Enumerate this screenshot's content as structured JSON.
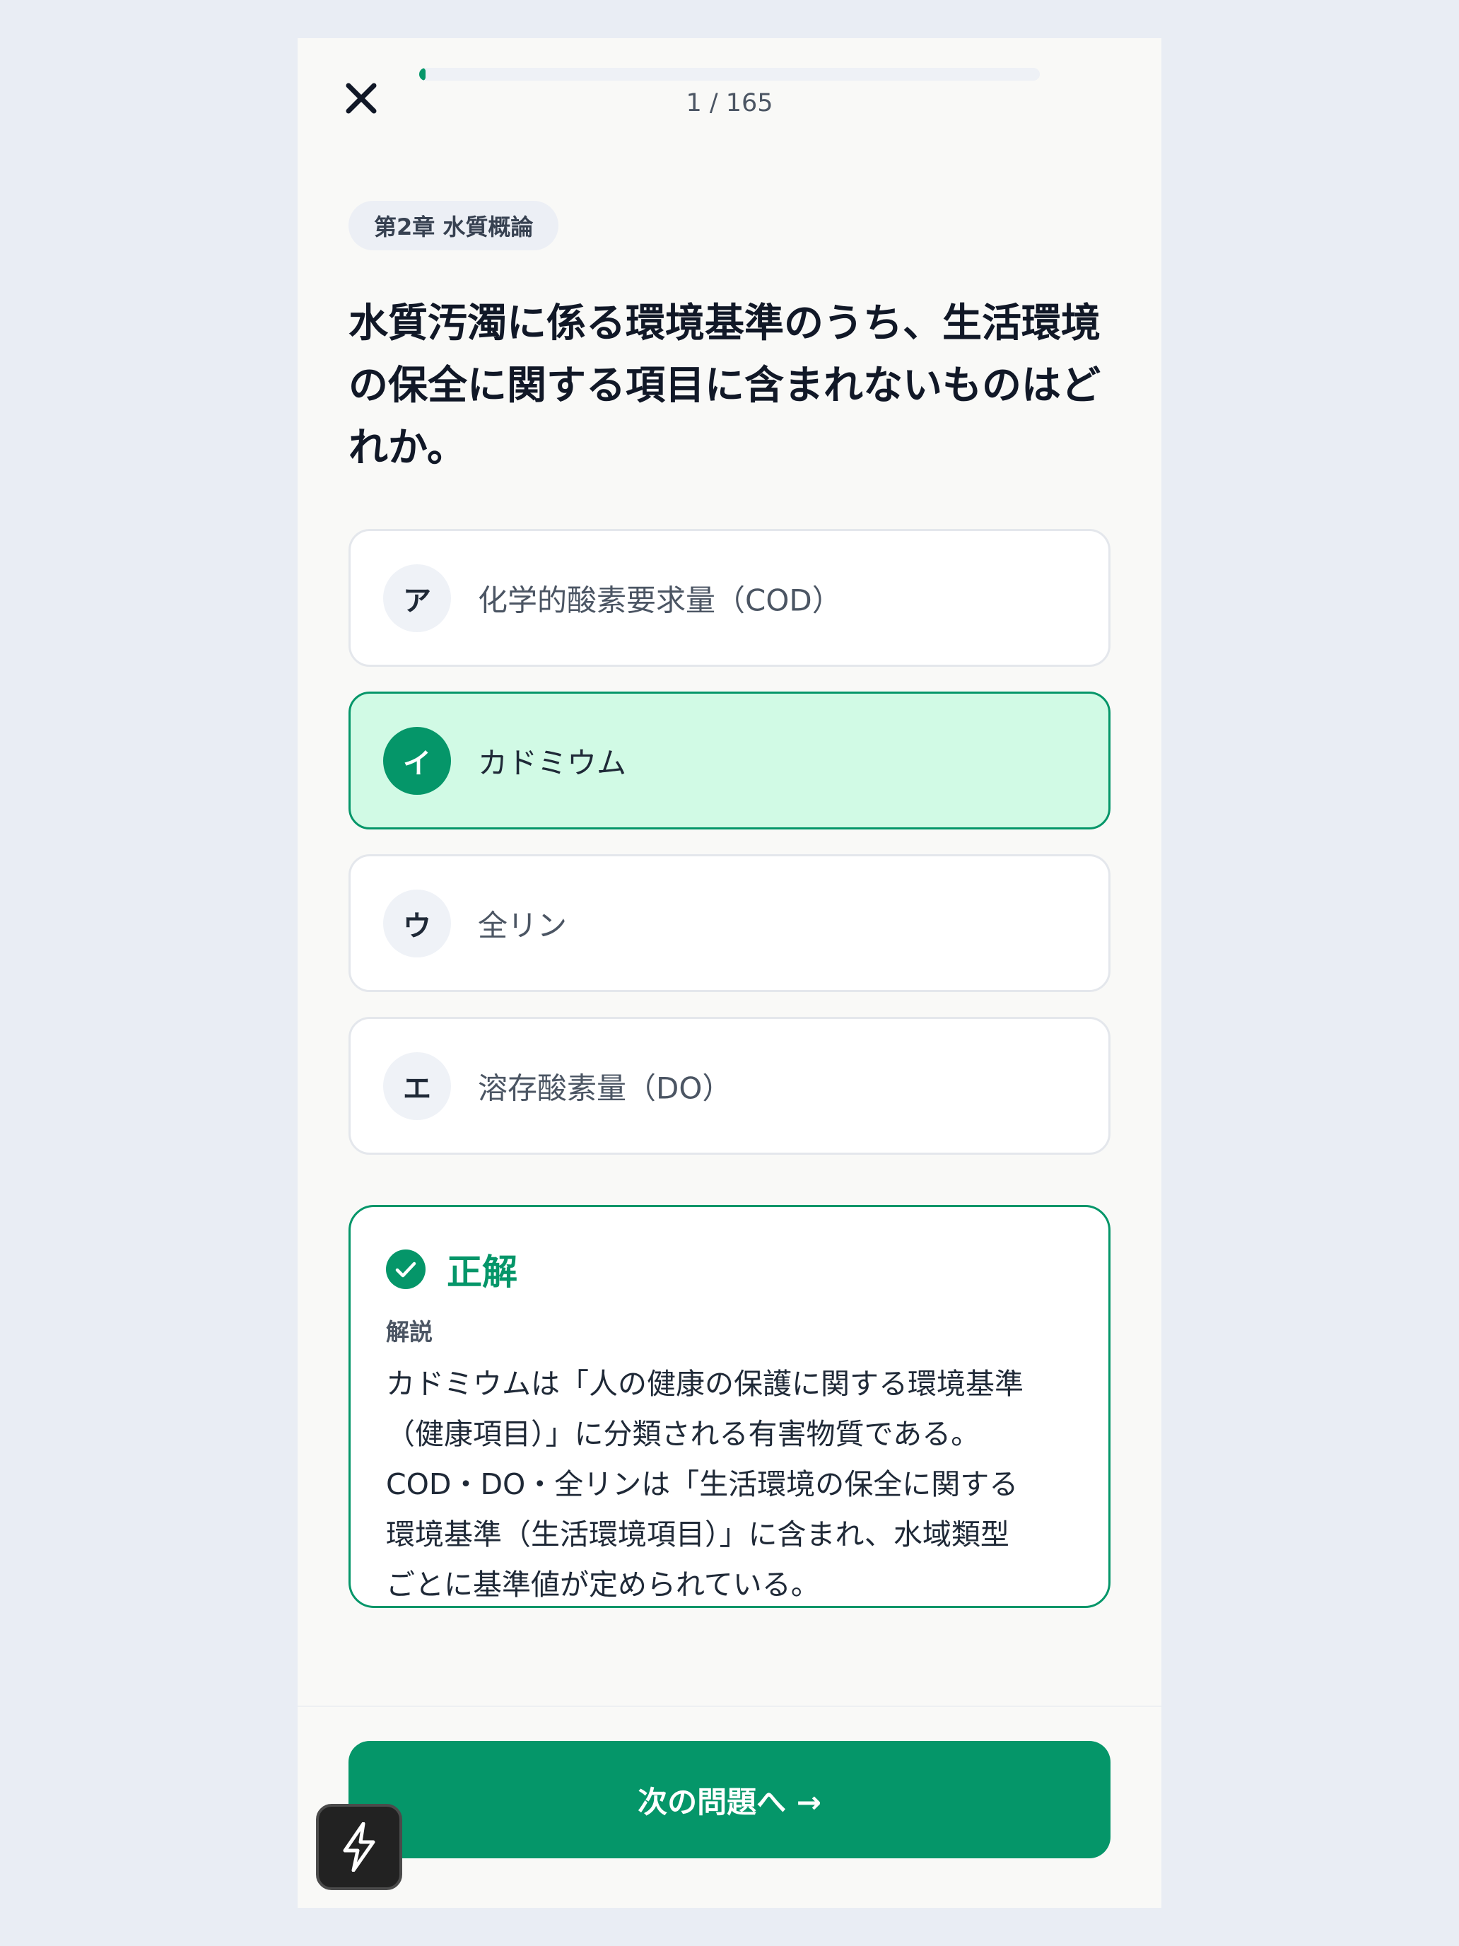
{
  "header": {
    "close_icon": "close-icon",
    "progress_fraction": 0.006,
    "progress_text": "1 / 165"
  },
  "chapter": "第2章 水質概論",
  "question": "水質汚濁に係る環境基準のうち、生活環境の保全に関する項目に含まれないものはどれか。",
  "options": [
    {
      "letter": "ア",
      "text": "化学的酸素要求量（COD）",
      "selected": false
    },
    {
      "letter": "イ",
      "text": "カドミウム",
      "selected": true
    },
    {
      "letter": "ウ",
      "text": "全リン",
      "selected": false
    },
    {
      "letter": "エ",
      "text": "溶存酸素量（DO）",
      "selected": false
    }
  ],
  "result": {
    "icon": "check-circle-icon",
    "label": "正解",
    "explanation_label": "解説",
    "explanation_lines": [
      "カドミウムは「人の健康の保護に関する環境基準",
      "（健康項目）」に分類される有害物質である。",
      "COD・DO・全リンは「生活環境の保全に関する",
      "環境基準（生活環境項目）」に含まれ、水域類型",
      "ごとに基準値が定められている。"
    ]
  },
  "next_button": "次の問題へ →",
  "fab_icon": "lightning-icon",
  "colors": {
    "accent": "#059669",
    "selected_bg": "#d1fae5",
    "page_bg": "#e9edf4",
    "card_bg": "#f9f9f7"
  }
}
